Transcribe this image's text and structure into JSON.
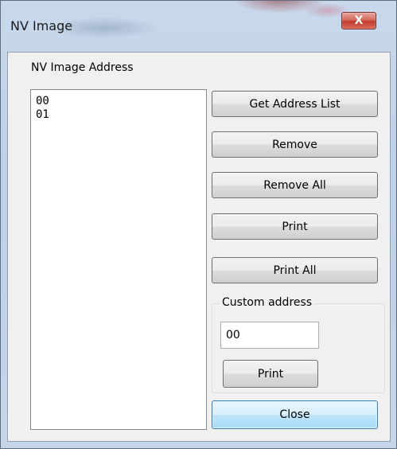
{
  "window": {
    "title": "NV Image",
    "close_glyph": "X"
  },
  "group": {
    "label": "NV Image Address"
  },
  "address_list": {
    "items": [
      "00",
      "01"
    ]
  },
  "buttons": {
    "get_address_list": "Get Address List",
    "remove": "Remove",
    "remove_all": "Remove All",
    "print": "Print",
    "print_all": "Print All",
    "close": "Close"
  },
  "custom_address": {
    "legend": "Custom address",
    "value": "00",
    "print_label": "Print"
  },
  "colors": {
    "title_bar": "#bcd0e8",
    "close_button": "#c0392b",
    "dialog_background": "#f0f0f0",
    "default_button_border": "#3c7fb1"
  }
}
